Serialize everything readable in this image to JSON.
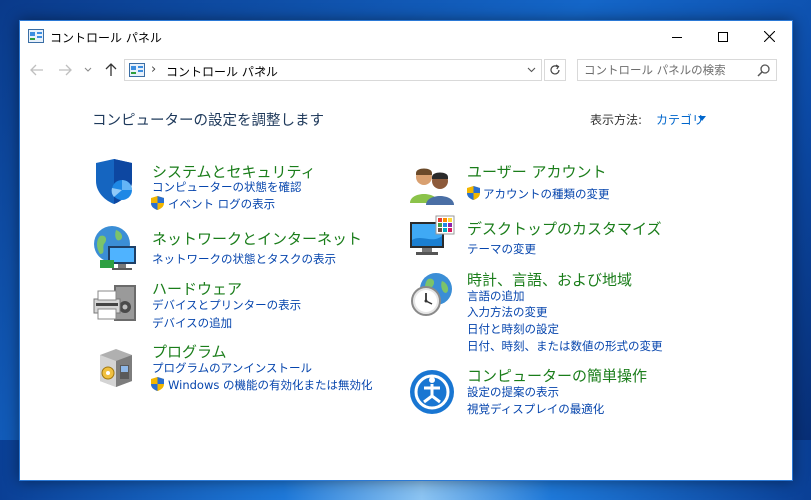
{
  "window": {
    "title": "コントロール パネル"
  },
  "address_bar": {
    "crumb": "コントロール パネル",
    "separator": "›"
  },
  "search": {
    "placeholder": "コントロール パネルの検索"
  },
  "content": {
    "heading": "コンピューターの設定を調整します",
    "view_by_label": "表示方法:",
    "view_by_value": "カテゴリ"
  },
  "categories": [
    {
      "title": "システムとセキュリティ",
      "icon": "security-shield-icon",
      "links": [
        {
          "label": "コンピューターの状態を確認",
          "shield": false
        },
        {
          "label": "イベント ログの表示",
          "shield": true
        }
      ]
    },
    {
      "title": "ネットワークとインターネット",
      "icon": "network-globe-icon",
      "links": [
        {
          "label": "ネットワークの状態とタスクの表示",
          "shield": false
        }
      ]
    },
    {
      "title": "ハードウェア",
      "icon": "printer-hardware-icon",
      "links": [
        {
          "label": "デバイスとプリンターの表示",
          "shield": false
        },
        {
          "label": "デバイスの追加",
          "shield": false
        }
      ]
    },
    {
      "title": "プログラム",
      "icon": "programs-box-icon",
      "links": [
        {
          "label": "プログラムのアンインストール",
          "shield": false
        },
        {
          "label": "Windows の機能の有効化または無効化",
          "shield": true
        }
      ]
    },
    {
      "title": "ユーザー アカウント",
      "icon": "user-accounts-icon",
      "links": [
        {
          "label": "アカウントの種類の変更",
          "shield": true
        }
      ]
    },
    {
      "title": "デスクトップのカスタマイズ",
      "icon": "monitor-palette-icon",
      "links": [
        {
          "label": "テーマの変更",
          "shield": false
        }
      ]
    },
    {
      "title": "時計、言語、および地域",
      "icon": "clock-globe-icon",
      "links": [
        {
          "label": "言語の追加",
          "shield": false
        },
        {
          "label": "入力方法の変更",
          "shield": false
        },
        {
          "label": "日付と時刻の設定",
          "shield": false
        },
        {
          "label": "日付、時刻、または数値の形式の変更",
          "shield": false
        }
      ]
    },
    {
      "title": "コンピューターの簡単操作",
      "icon": "ease-of-access-icon",
      "links": [
        {
          "label": "設定の提案の表示",
          "shield": false
        },
        {
          "label": "視覚ディスプレイの最適化",
          "shield": false
        }
      ]
    }
  ],
  "colors": {
    "category_title": "#1a7d1a",
    "link": "#0645ad",
    "heading": "#1e395b",
    "window_border": "#2b79d6"
  }
}
